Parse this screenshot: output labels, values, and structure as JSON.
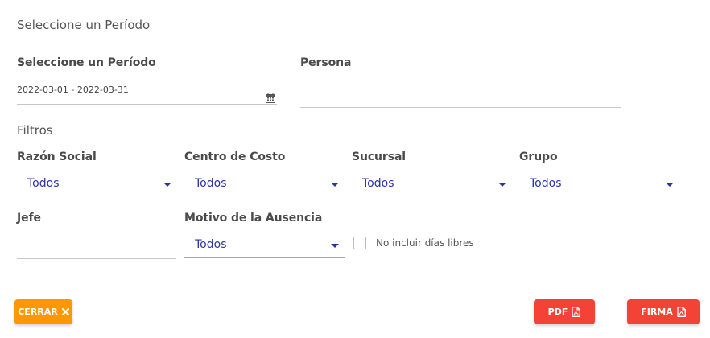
{
  "header": {
    "title": "Seleccione un Período"
  },
  "period": {
    "label": "Seleccione un Período",
    "value": "2022-03-01 - 2022-03-31"
  },
  "persona": {
    "label": "Persona",
    "value": ""
  },
  "filters": {
    "title": "Filtros",
    "razon_social": {
      "label": "Razón Social",
      "value": "Todos"
    },
    "centro_costo": {
      "label": "Centro de Costo",
      "value": "Todos"
    },
    "sucursal": {
      "label": "Sucursal",
      "value": "Todos"
    },
    "grupo": {
      "label": "Grupo",
      "value": "Todos"
    },
    "jefe": {
      "label": "Jefe",
      "value": ""
    },
    "motivo": {
      "label": "Motivo de la Ausencia",
      "value": "Todos"
    },
    "no_dias_libres": {
      "label": "No incluir días libres",
      "checked": false
    }
  },
  "buttons": {
    "cerrar": "CERRAR",
    "pdf": "PDF",
    "firma": "FIRMA"
  },
  "colors": {
    "accent_text": "#2b35a0",
    "orange": "#ff9800",
    "red": "#f44336"
  }
}
